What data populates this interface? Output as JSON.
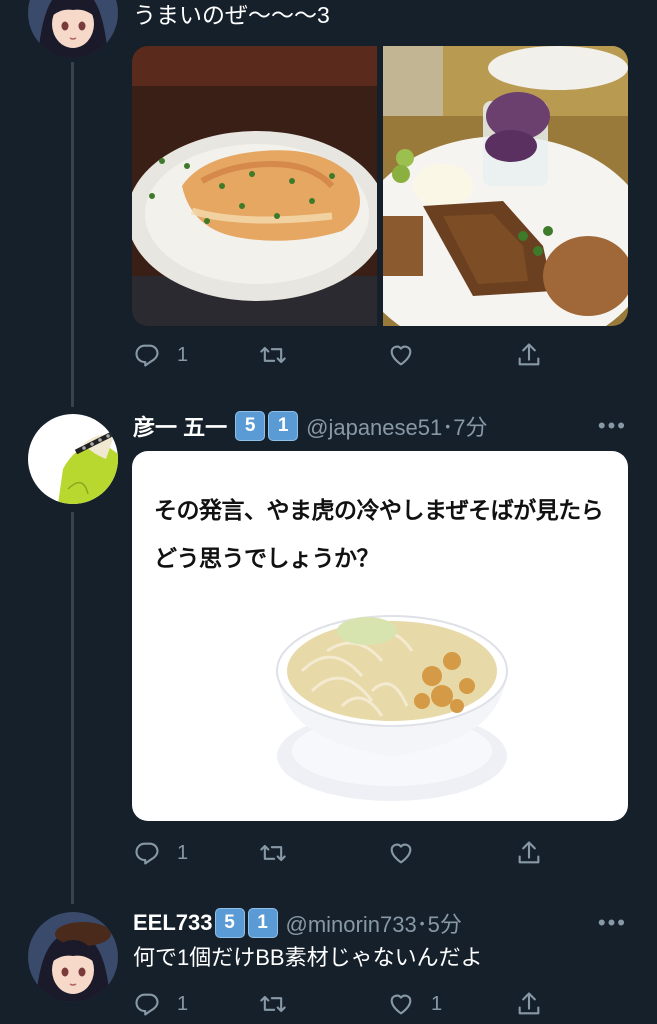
{
  "colors": {
    "background": "#15202b",
    "secondary_text": "#8899a6",
    "thread_line": "#38444d",
    "badge": "#5b9bd5"
  },
  "tweet1": {
    "text": "うまいのぜ〜〜〜3",
    "images": [
      "lasagna-photo",
      "dessert-plate-photo"
    ],
    "actions": {
      "reply_count": "1",
      "retweet_count": "",
      "like_count": ""
    }
  },
  "tweet2": {
    "display_name": "彦一 五一",
    "badges": [
      "5",
      "1"
    ],
    "handle_time": "@japanese51･7分",
    "image_text_line1": "その発言、やま虎の冷やしまぜそばが見たら",
    "image_text_line2": "どう思うでしょうか？",
    "image": "mazesoba-bowl-photo",
    "actions": {
      "reply_count": "1",
      "retweet_count": "",
      "like_count": ""
    }
  },
  "tweet3": {
    "display_name": "EEL733",
    "badges": [
      "5",
      "1"
    ],
    "handle_time": "@minorin733･5分",
    "text": "何で1個だけBB素材じゃないんだよ",
    "actions": {
      "reply_count": "1",
      "retweet_count": "",
      "like_count": "1"
    }
  },
  "icons": [
    "reply-icon",
    "retweet-icon",
    "like-icon",
    "share-icon",
    "more-icon"
  ]
}
